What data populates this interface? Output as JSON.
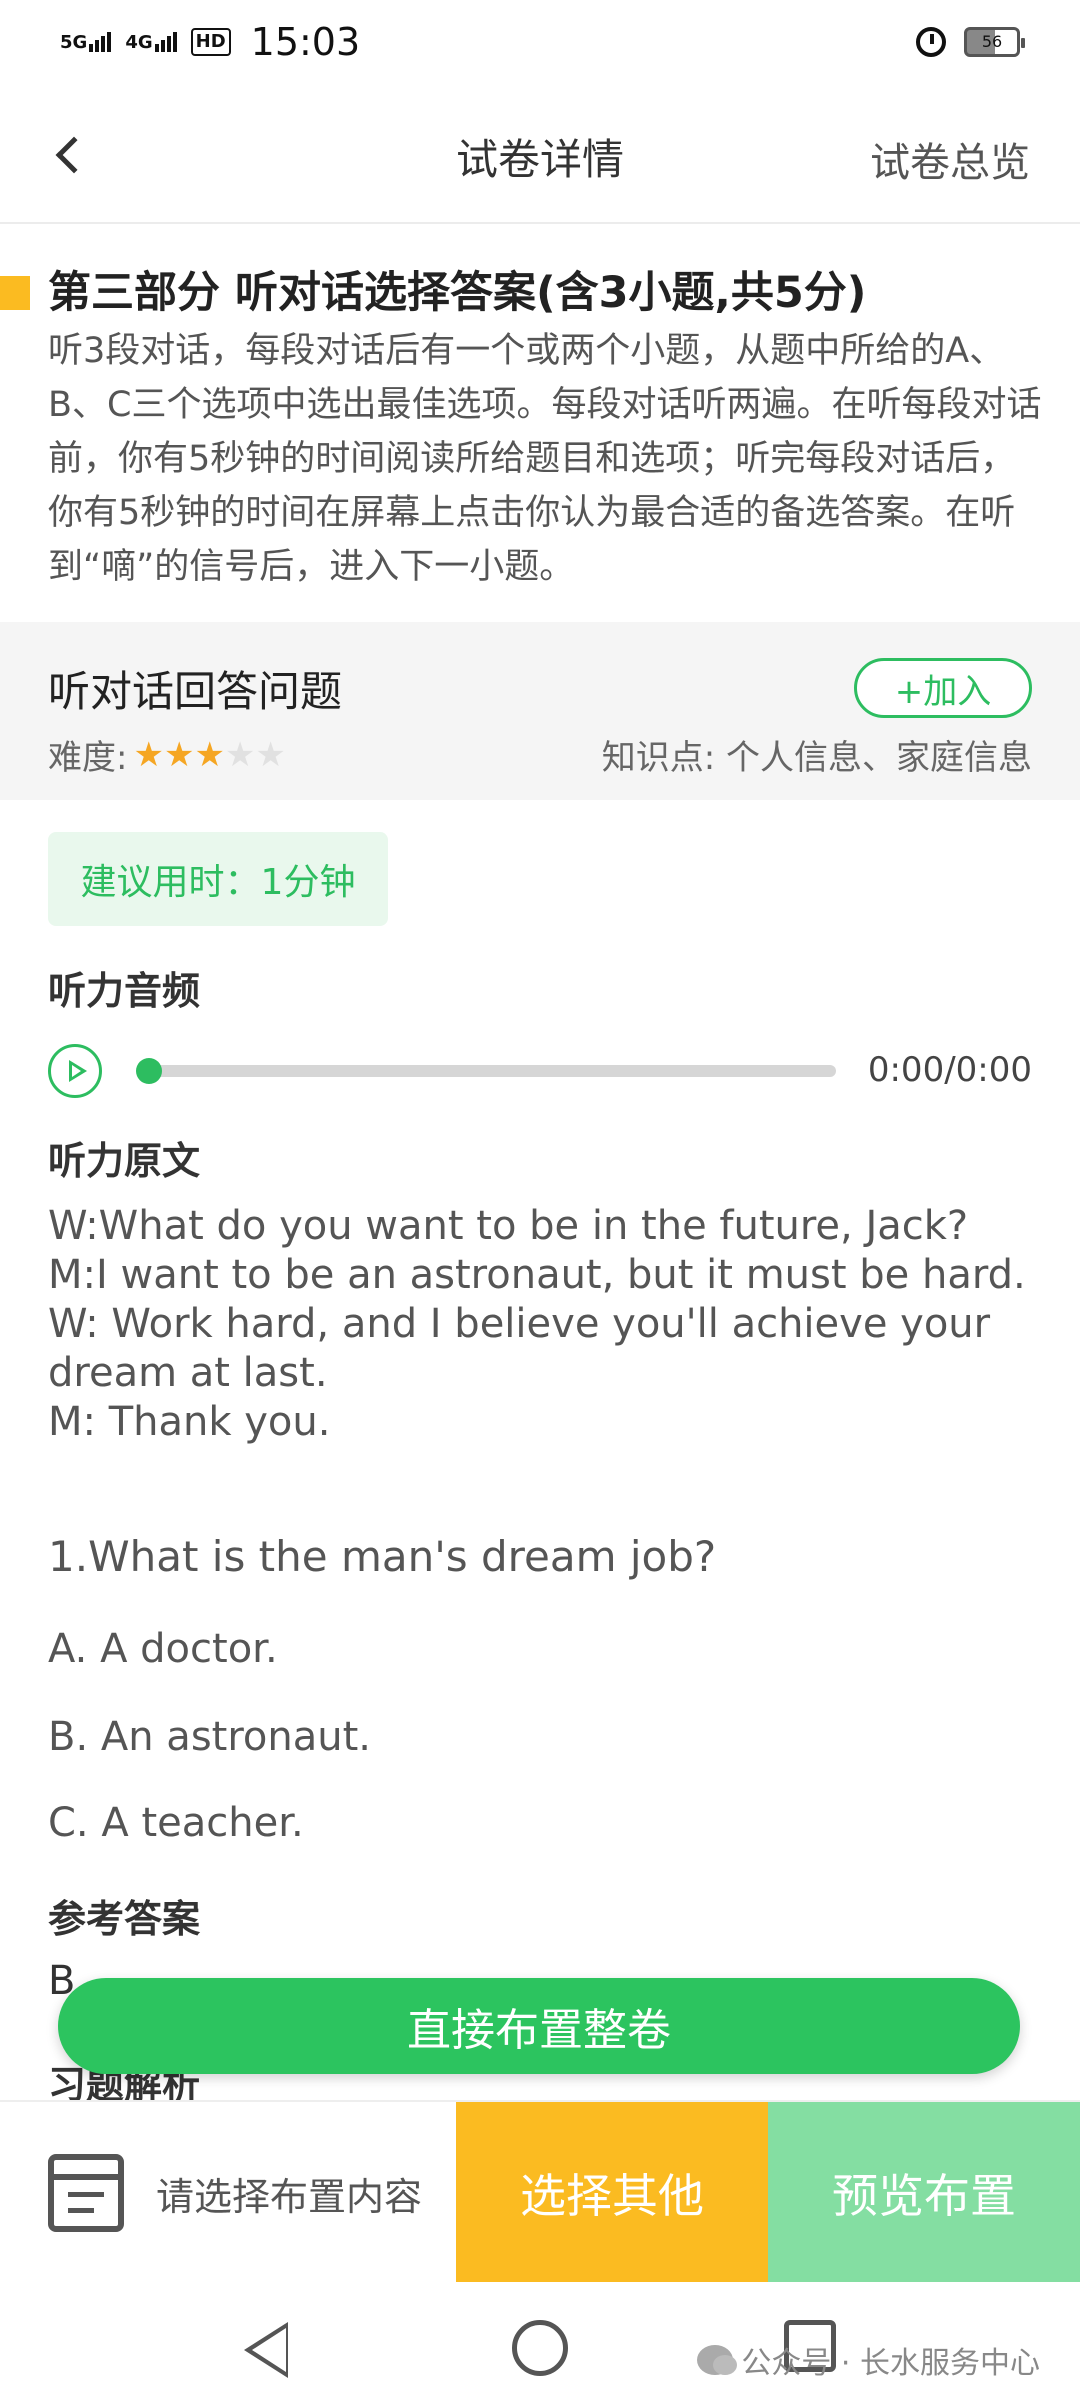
{
  "status_bar": {
    "net1": "5G",
    "net2": "4G",
    "hd": "HD",
    "time": "15:03",
    "battery": "56"
  },
  "header": {
    "title": "试卷详情",
    "overview_link": "试卷总览"
  },
  "section": {
    "title": "第三部分 听对话选择答案(含3小题,共5分)",
    "description": "听3段对话，每段对话后有一个或两个小题，从题中所给的A、B、C三个选项中选出最佳选项。每段对话听两遍。在听每段对话前，你有5秒钟的时间阅读所给题目和选项；听完每段对话后，你有5秒钟的时间在屏幕上点击你认为最合适的备选答案。在听到“嘀”的信号后，进入下一小题。"
  },
  "question_block": {
    "title": "听对话回答问题",
    "add_button": "+加入",
    "difficulty_label": "难度:",
    "difficulty_stars": 3,
    "difficulty_max": 5,
    "knowledge": "知识点: 个人信息、家庭信息"
  },
  "suggested_time": "建议用时：1分钟",
  "audio": {
    "heading": "听力音频",
    "time": "0:00/0:00",
    "progress": 0
  },
  "transcript": {
    "heading": "听力原文",
    "lines": [
      "W:What do you want to be in the future, Jack?",
      "M:I want to be an astronaut, but it must be hard.",
      "W: Work hard, and I believe you'll achieve your dream at last.",
      "M: Thank you."
    ]
  },
  "question": {
    "text": "1.What is the man's dream job?",
    "options": [
      "A. A doctor.",
      "B. An astronaut.",
      "C. A teacher."
    ]
  },
  "answer": {
    "heading": "参考答案",
    "value": "B"
  },
  "explanation_heading": "习题解析",
  "assign_all_button": "直接布置整卷",
  "bottom_bar": {
    "hint": "请选择布置内容",
    "select_other": "选择其他",
    "preview": "预览布置"
  },
  "watermark": "公众号 · 长水服务中心",
  "colors": {
    "accent_green": "#2dbd60",
    "accent_yellow": "#fbbb21",
    "preview_green": "#84dea2",
    "star": "#f5a623"
  }
}
